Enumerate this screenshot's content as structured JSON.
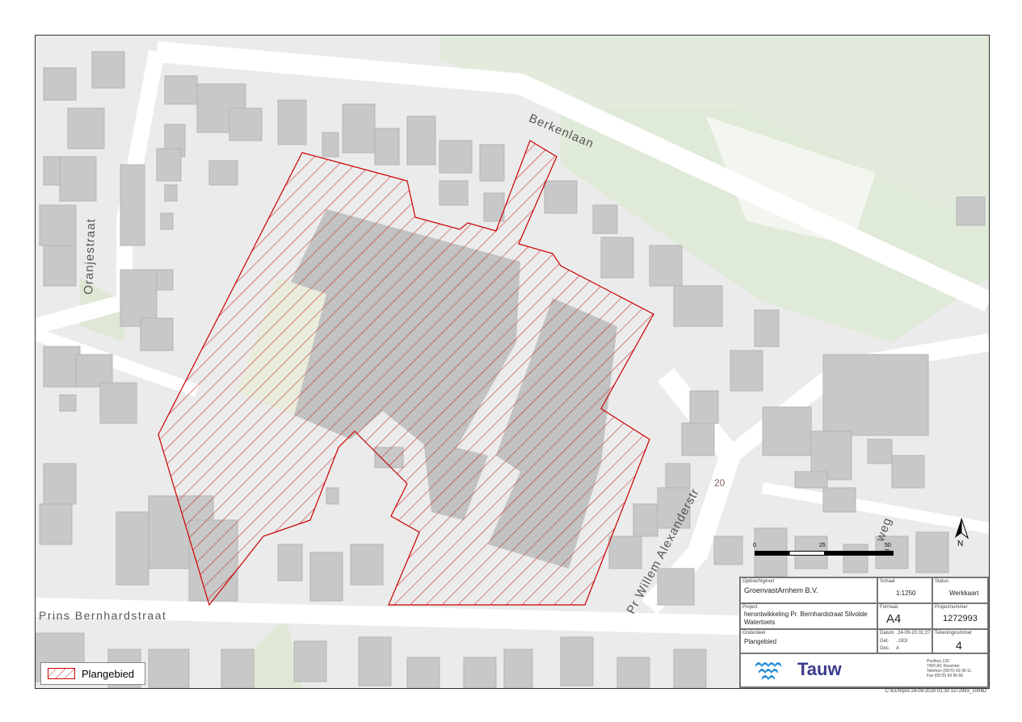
{
  "streets": {
    "berkenlaan": "Berkenlaan",
    "oranjestraat": "Oranjestraat",
    "prins_bernhardstraat": "Prins Bernhardstraat",
    "pr_willem_alexanderstr": "Pr Willem Alexanderstr",
    "weg_fragment": "weg",
    "contour_label": "20"
  },
  "legend": {
    "label": "Plangebied",
    "color": "#cc0000"
  },
  "scale": {
    "tick0": "0",
    "tick1": "25",
    "tick2": "50 m"
  },
  "north": {
    "label": "N"
  },
  "title_block": {
    "opdrachtgever_label": "Opdrachtgever",
    "opdrachtgever": "GroenvastArnhem B.V.",
    "schaal_label": "Schaal",
    "schaal": "1:1250",
    "status_label": "Status",
    "status": "Werkkaart",
    "project_label": "Project",
    "project": "herontwikkeling Pr. Bernhardstraat Silvolde Watertoets",
    "formaat_label": "Formaat",
    "formaat": "A4",
    "projectnummer_label": "Projectnummer",
    "projectnummer": "1272993",
    "onderdeel_label": "Onderdeel",
    "onderdeel": "Plangebied",
    "datum_label": "Datum",
    "datum": "24-09-20 01:27",
    "get_label": "Get.",
    "get": "..OOI",
    "gec_label": "Gec.",
    "gec": "A",
    "tekeningnummer_label": "Tekeningnummer",
    "tekeningnummer": "4",
    "company": "Tauw",
    "company_color": "#3a3a8c",
    "address_line1": "Postbus 133",
    "address_line2": "7400 AC Deventer",
    "address_line3": "Telefoon (0570) 69 99 11",
    "address_line4": "Fax (0570) 69 96 66"
  },
  "footer_code": "C:\\EEN\\pro 24-09-2020 01:30 1272993_1004D"
}
